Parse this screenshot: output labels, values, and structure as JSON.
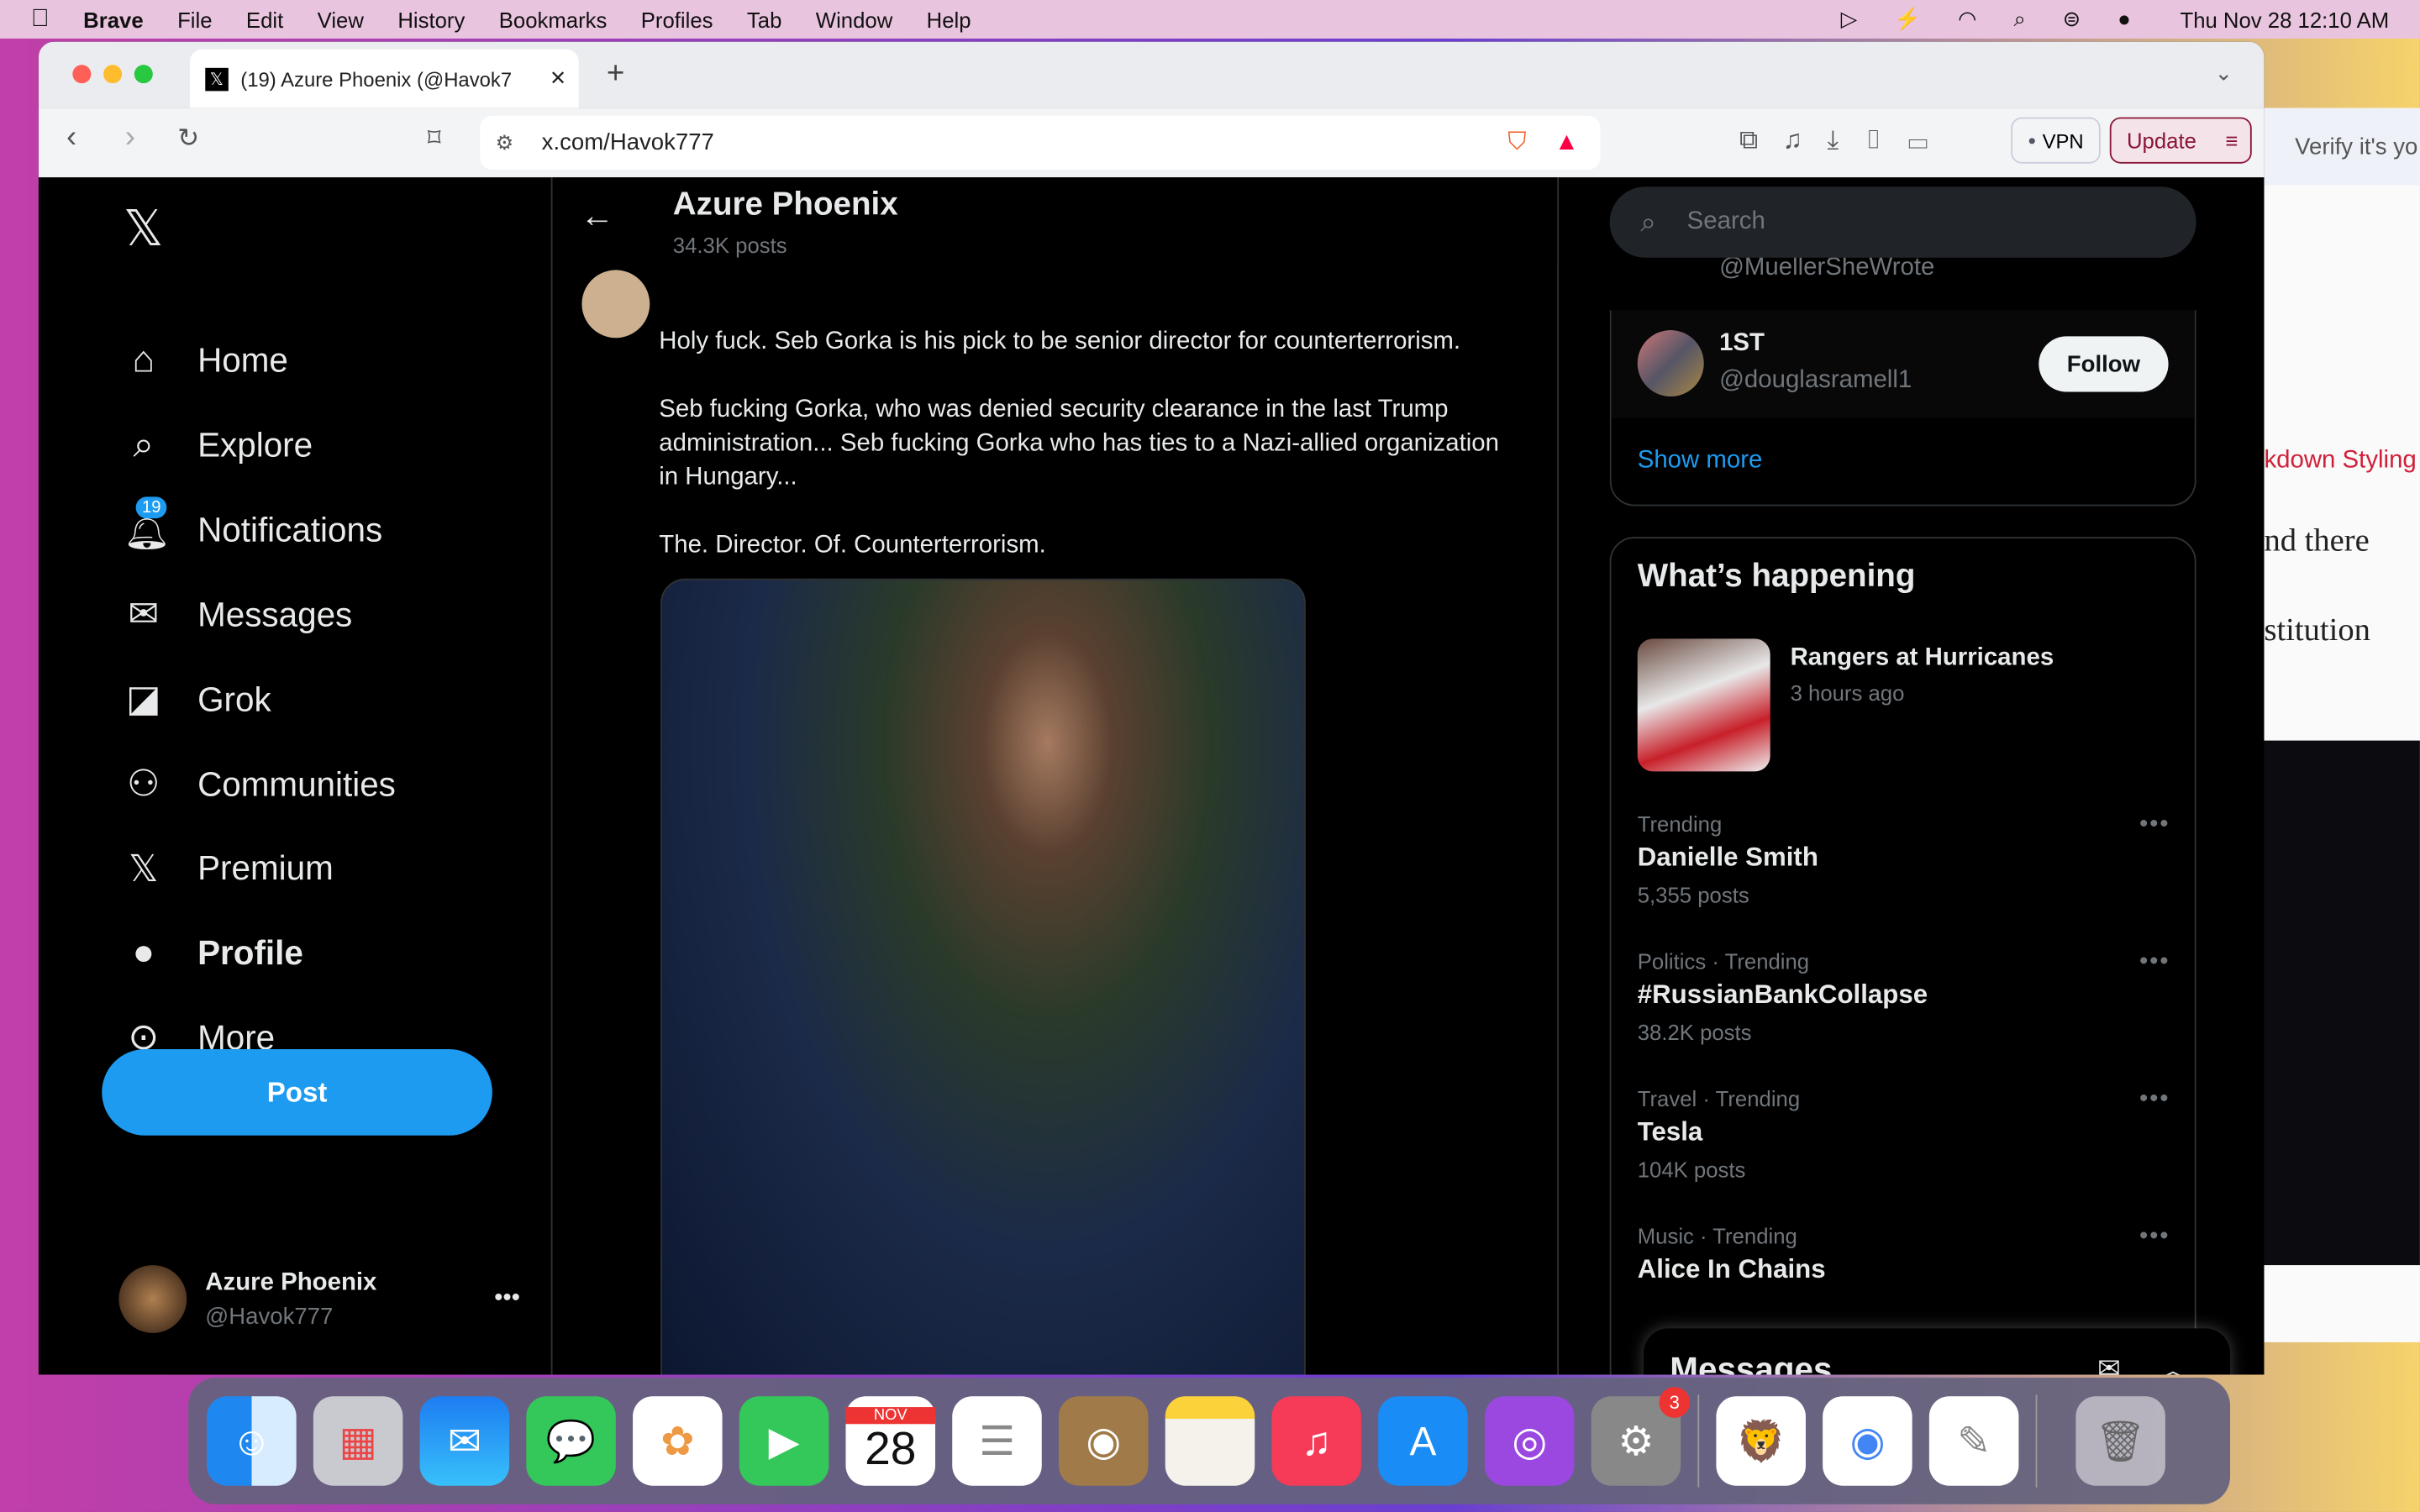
{
  "menubar": {
    "app": "Brave",
    "items": [
      "File",
      "Edit",
      "View",
      "History",
      "Bookmarks",
      "Profiles",
      "Tab",
      "Window",
      "Help"
    ],
    "clock": "Thu Nov 28  12:10 AM"
  },
  "browser": {
    "tab_title": "(19) Azure Phoenix (@Havok7",
    "url": "x.com/Havok777",
    "vpn": "VPN",
    "update": "Update"
  },
  "nav": {
    "items": [
      {
        "label": "Home",
        "icon": "home-icon"
      },
      {
        "label": "Explore",
        "icon": "search-icon"
      },
      {
        "label": "Notifications",
        "icon": "bell-icon",
        "badge": "19"
      },
      {
        "label": "Messages",
        "icon": "mail-icon"
      },
      {
        "label": "Grok",
        "icon": "grok-icon"
      },
      {
        "label": "Communities",
        "icon": "people-icon"
      },
      {
        "label": "Premium",
        "icon": "x-icon"
      },
      {
        "label": "Profile",
        "icon": "person-icon"
      },
      {
        "label": "More",
        "icon": "more-circle-icon"
      }
    ],
    "post": "Post",
    "account_name": "Azure Phoenix",
    "account_handle": "@Havok777"
  },
  "header": {
    "title": "Azure Phoenix",
    "posts": "34.3K posts"
  },
  "tweet": {
    "paragraphs": [
      "Holy fuck. Seb Gorka is his pick to be senior director for counterterrorism.",
      "Seb fucking Gorka, who was denied security clearance in the last Trump administration... Seb fucking Gorka who has ties to a Nazi-allied organization in Hungary...",
      "The. Director. Of. Counterterrorism."
    ]
  },
  "search": {
    "placeholder": "Search"
  },
  "who_to_follow": {
    "partial_handle": "@MuellerSheWrote",
    "user": {
      "name": "1ST",
      "handle": "@douglasramell1",
      "button": "Follow"
    },
    "show_more": "Show more"
  },
  "happening": {
    "title": "What’s happening",
    "event": {
      "title": "Rangers at Hurricanes",
      "time": "3 hours ago"
    },
    "trends": [
      {
        "context": "Trending",
        "title": "Danielle Smith",
        "posts": "5,355 posts"
      },
      {
        "context": "Politics · Trending",
        "title": "#RussianBankCollapse",
        "posts": "38.2K posts"
      },
      {
        "context": "Travel · Trending",
        "title": "Tesla",
        "posts": "104K posts"
      },
      {
        "context": "Music · Trending",
        "title": "Alice In Chains",
        "posts": ""
      }
    ]
  },
  "messages_drawer": {
    "title": "Messages"
  },
  "background_window": {
    "snippets": [
      "Verify it's yo",
      "kdown Styling",
      "nd there",
      "stitution"
    ]
  },
  "dock": {
    "calendar_month": "NOV",
    "calendar_day": "28",
    "settings_badge": "3"
  }
}
